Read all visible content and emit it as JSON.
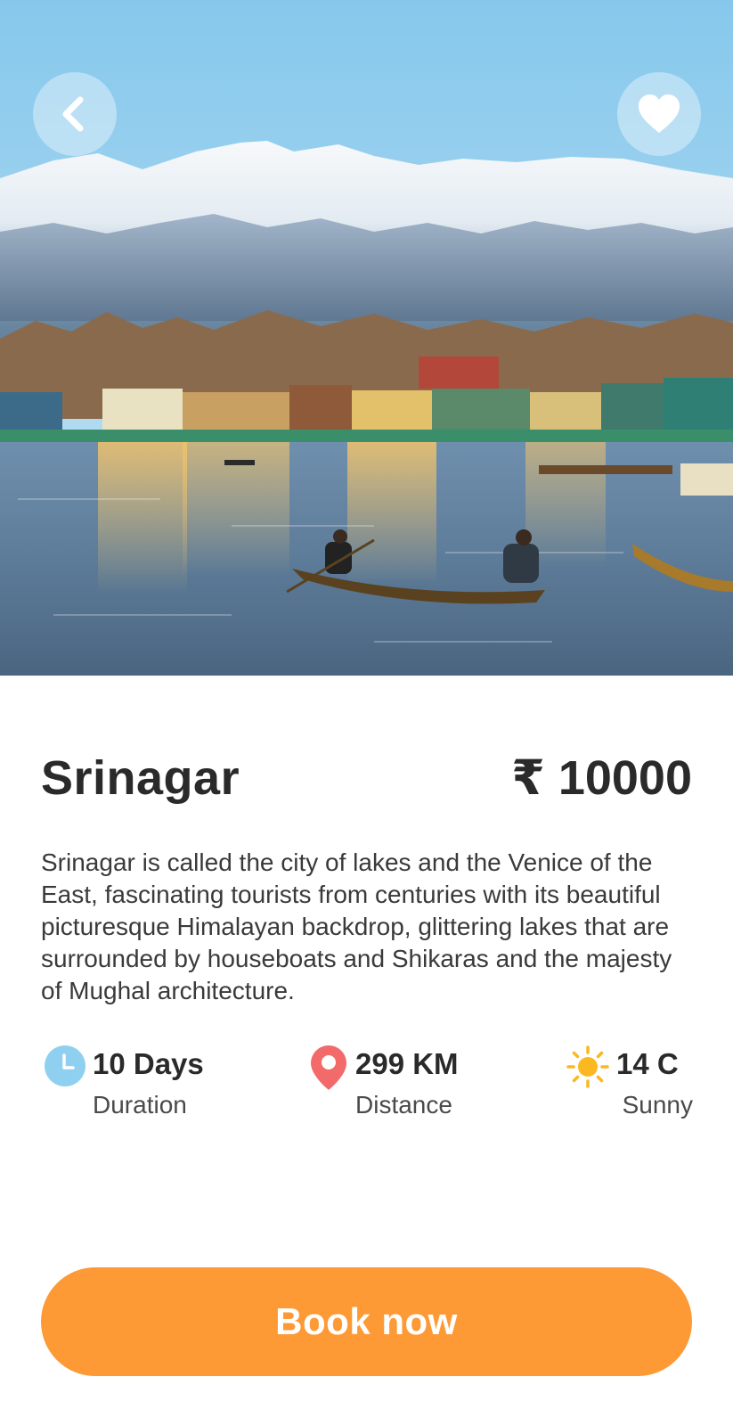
{
  "header": {
    "back_icon": "chevron-left-icon",
    "favorite_icon": "heart-icon"
  },
  "hero": {
    "image": "Srinagar Dal Lake with snow-capped mountains and shikara boat"
  },
  "place": {
    "name": "Srinagar",
    "price": "₹ 10000",
    "description": "Srinagar is called the city of lakes and the Venice of the East, fascinating tourists from centuries with its beautiful picturesque Himalayan backdrop, glittering lakes that are surrounded by houseboats and Shikaras and the majesty of Mughal architecture."
  },
  "stats": {
    "duration": {
      "value": "10 Days",
      "label": "Duration",
      "icon": "clock-icon",
      "color": "#8fd0f0"
    },
    "distance": {
      "value": "299 KM",
      "label": "Distance",
      "icon": "location-pin-icon",
      "color": "#f26a6a"
    },
    "weather": {
      "value": "14 C",
      "label": "Sunny",
      "icon": "sun-icon",
      "color": "#fbb820"
    }
  },
  "actions": {
    "book_label": "Book now",
    "book_color": "#fd9a35"
  }
}
